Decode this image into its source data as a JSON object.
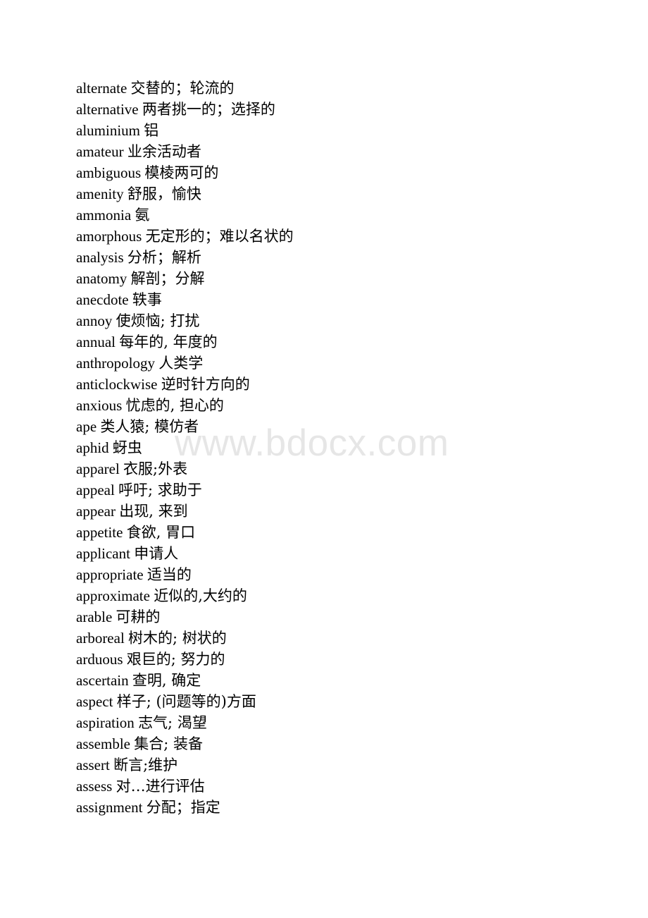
{
  "document": {
    "type": "vocabulary-word-list",
    "background_color": "#ffffff",
    "text_color": "#000000"
  },
  "watermark": {
    "text": "www.bdocx.com",
    "color": "#e6e6e6"
  },
  "entries": [
    {
      "term": "alternate",
      "gloss": "交替的；轮流的"
    },
    {
      "term": "alternative",
      "gloss": "两者挑一的；选择的"
    },
    {
      "term": "aluminium",
      "gloss": "铝"
    },
    {
      "term": "amateur",
      "gloss": "业余活动者"
    },
    {
      "term": "ambiguous",
      "gloss": "模棱两可的"
    },
    {
      "term": "amenity",
      "gloss": "舒服，愉快"
    },
    {
      "term": "ammonia",
      "gloss": "氨"
    },
    {
      "term": "amorphous",
      "gloss": "无定形的；难以名状的"
    },
    {
      "term": "analysis",
      "gloss": "分析；解析"
    },
    {
      "term": "anatomy",
      "gloss": "解剖；分解"
    },
    {
      "term": "anecdote",
      "gloss": "轶事"
    },
    {
      "term": "annoy",
      "gloss": "使烦恼; 打扰"
    },
    {
      "term": "annual",
      "gloss": "每年的, 年度的"
    },
    {
      "term": "anthropology",
      "gloss": "人类学"
    },
    {
      "term": "anticlockwise",
      "gloss": "逆时针方向的"
    },
    {
      "term": "anxious",
      "gloss": "忧虑的, 担心的"
    },
    {
      "term": "ape",
      "gloss": "类人猿; 模仿者"
    },
    {
      "term": "aphid",
      "gloss": "蚜虫"
    },
    {
      "term": "apparel",
      "gloss": "衣服;外表"
    },
    {
      "term": "appeal",
      "gloss": "呼吁; 求助于"
    },
    {
      "term": "appear",
      "gloss": "出现, 来到"
    },
    {
      "term": "appetite",
      "gloss": "食欲, 胃口"
    },
    {
      "term": "applicant",
      "gloss": "申请人"
    },
    {
      "term": "appropriate",
      "gloss": "适当的"
    },
    {
      "term": "approximate",
      "gloss": "近似的,大约的"
    },
    {
      "term": "arable",
      "gloss": "可耕的"
    },
    {
      "term": "arboreal",
      "gloss": "树木的; 树状的"
    },
    {
      "term": "arduous",
      "gloss": "艰巨的; 努力的"
    },
    {
      "term": "ascertain",
      "gloss": "查明, 确定"
    },
    {
      "term": "aspect",
      "gloss": "样子; (问题等的)方面"
    },
    {
      "term": "aspiration",
      "gloss": "志气; 渴望"
    },
    {
      "term": "assemble",
      "gloss": "集合; 装备"
    },
    {
      "term": "assert",
      "gloss": "断言;维护"
    },
    {
      "term": "assess",
      "gloss": "对…进行评估"
    },
    {
      "term": "assignment",
      "gloss": "分配；指定"
    }
  ]
}
